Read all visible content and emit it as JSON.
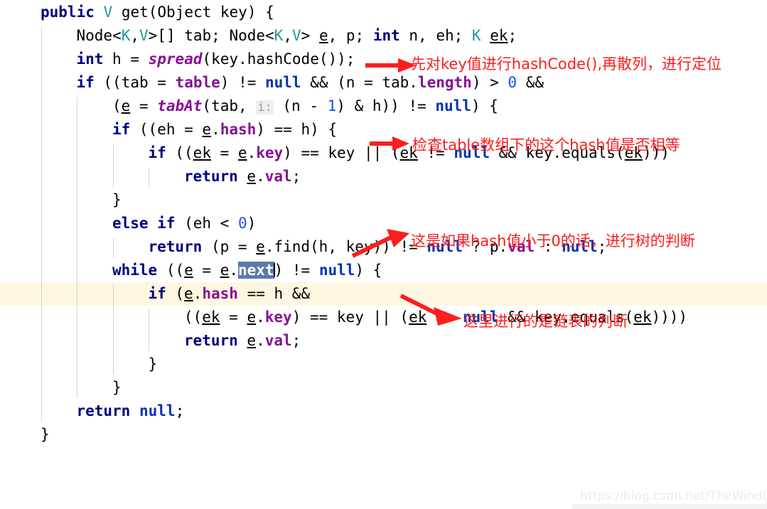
{
  "editor": {
    "language": "java",
    "highlighted_line_index": 12,
    "selection": {
      "text": "next",
      "line_index": 12
    },
    "inlay_hints": [
      {
        "text": "i:",
        "line_index": 4
      }
    ],
    "colors": {
      "background": "#ffffff",
      "caret_row": "#fdf6e0",
      "selection": "#5b79ad",
      "keyword": "#000080",
      "type_param": "#20999d",
      "field": "#871094",
      "number": "#1750eb",
      "null_keyword": "#0033b3",
      "indent_guide": "#d4d4d4",
      "annotation_red": "#fc1d1d"
    },
    "lines": [
      {
        "indent": 0,
        "tokens": [
          {
            "t": "public",
            "c": "kw"
          },
          {
            "t": " ",
            "c": "plain"
          },
          {
            "t": "V",
            "c": "type"
          },
          {
            "t": " get(Object key) {",
            "c": "plain"
          }
        ]
      },
      {
        "indent": 1,
        "tokens": [
          {
            "t": "Node<",
            "c": "plain"
          },
          {
            "t": "K",
            "c": "type"
          },
          {
            "t": ",",
            "c": "plain"
          },
          {
            "t": "V",
            "c": "type"
          },
          {
            "t": ">[] tab; Node<",
            "c": "plain"
          },
          {
            "t": "K",
            "c": "type"
          },
          {
            "t": ",",
            "c": "plain"
          },
          {
            "t": "V",
            "c": "type"
          },
          {
            "t": "> ",
            "c": "plain"
          },
          {
            "t": "e",
            "c": "localvar"
          },
          {
            "t": ", p; ",
            "c": "plain"
          },
          {
            "t": "int",
            "c": "kw"
          },
          {
            "t": " n, eh; ",
            "c": "plain"
          },
          {
            "t": "K",
            "c": "type"
          },
          {
            "t": " ",
            "c": "plain"
          },
          {
            "t": "ek",
            "c": "localvar"
          },
          {
            "t": ";",
            "c": "plain"
          }
        ]
      },
      {
        "indent": 1,
        "tokens": [
          {
            "t": "int",
            "c": "kw"
          },
          {
            "t": " h = ",
            "c": "plain"
          },
          {
            "t": "spread",
            "c": "static"
          },
          {
            "t": "(key.hashCode());",
            "c": "plain"
          }
        ]
      },
      {
        "indent": 1,
        "tokens": [
          {
            "t": "if",
            "c": "kw"
          },
          {
            "t": " ((tab = ",
            "c": "plain"
          },
          {
            "t": "table",
            "c": "field"
          },
          {
            "t": ") != ",
            "c": "plain"
          },
          {
            "t": "null",
            "c": "nullkw"
          },
          {
            "t": " && (n = tab.",
            "c": "plain"
          },
          {
            "t": "length",
            "c": "field"
          },
          {
            "t": ") > ",
            "c": "plain"
          },
          {
            "t": "0",
            "c": "num"
          },
          {
            "t": " &&",
            "c": "plain"
          }
        ]
      },
      {
        "indent": 2,
        "tokens": [
          {
            "t": "(",
            "c": "plain"
          },
          {
            "t": "e",
            "c": "localvar"
          },
          {
            "t": " = ",
            "c": "plain"
          },
          {
            "t": "tabAt",
            "c": "static"
          },
          {
            "t": "(tab, ",
            "c": "plain"
          },
          {
            "t": "i:",
            "c": "inlay"
          },
          {
            "t": " (n - ",
            "c": "plain"
          },
          {
            "t": "1",
            "c": "num"
          },
          {
            "t": ") & h)) != ",
            "c": "plain"
          },
          {
            "t": "null",
            "c": "nullkw"
          },
          {
            "t": ") {",
            "c": "plain"
          }
        ]
      },
      {
        "indent": 2,
        "tokens": [
          {
            "t": "if",
            "c": "kw"
          },
          {
            "t": " ((eh = ",
            "c": "plain"
          },
          {
            "t": "e",
            "c": "localvar"
          },
          {
            "t": ".",
            "c": "plain"
          },
          {
            "t": "hash",
            "c": "field"
          },
          {
            "t": ") == h) {",
            "c": "plain"
          }
        ]
      },
      {
        "indent": 3,
        "tokens": [
          {
            "t": "if",
            "c": "kw"
          },
          {
            "t": " ((",
            "c": "plain"
          },
          {
            "t": "ek",
            "c": "localvar"
          },
          {
            "t": " = ",
            "c": "plain"
          },
          {
            "t": "e",
            "c": "localvar"
          },
          {
            "t": ".",
            "c": "plain"
          },
          {
            "t": "key",
            "c": "field"
          },
          {
            "t": ") == key || (",
            "c": "plain"
          },
          {
            "t": "ek",
            "c": "localvar"
          },
          {
            "t": " != ",
            "c": "plain"
          },
          {
            "t": "null",
            "c": "nullkw"
          },
          {
            "t": " && key.equals(",
            "c": "plain"
          },
          {
            "t": "ek",
            "c": "localvar"
          },
          {
            "t": ")))",
            "c": "plain"
          }
        ]
      },
      {
        "indent": 4,
        "tokens": [
          {
            "t": "return",
            "c": "kw"
          },
          {
            "t": " ",
            "c": "plain"
          },
          {
            "t": "e",
            "c": "localvar"
          },
          {
            "t": ".",
            "c": "plain"
          },
          {
            "t": "val",
            "c": "field"
          },
          {
            "t": ";",
            "c": "plain"
          }
        ]
      },
      {
        "indent": 2,
        "tokens": [
          {
            "t": "}",
            "c": "plain"
          }
        ]
      },
      {
        "indent": 2,
        "tokens": [
          {
            "t": "else if",
            "c": "kw"
          },
          {
            "t": " (eh < ",
            "c": "plain"
          },
          {
            "t": "0",
            "c": "num"
          },
          {
            "t": ")",
            "c": "plain"
          }
        ]
      },
      {
        "indent": 3,
        "tokens": [
          {
            "t": "return",
            "c": "kw"
          },
          {
            "t": " (p = ",
            "c": "plain"
          },
          {
            "t": "e",
            "c": "localvar"
          },
          {
            "t": ".find(h, key)) != ",
            "c": "plain"
          },
          {
            "t": "null",
            "c": "nullkw"
          },
          {
            "t": " ? p.",
            "c": "plain"
          },
          {
            "t": "val",
            "c": "field"
          },
          {
            "t": " : ",
            "c": "plain"
          },
          {
            "t": "null",
            "c": "nullkw"
          },
          {
            "t": ";",
            "c": "plain"
          }
        ]
      },
      {
        "indent": 2,
        "tokens": [
          {
            "t": "while",
            "c": "kw"
          },
          {
            "t": " ((",
            "c": "plain"
          },
          {
            "t": "e",
            "c": "localvar"
          },
          {
            "t": " = ",
            "c": "plain"
          },
          {
            "t": "e",
            "c": "localvar"
          },
          {
            "t": ".",
            "c": "plain"
          },
          {
            "t": "next",
            "c": "sel"
          },
          {
            "t": ") != ",
            "c": "plain"
          },
          {
            "t": "null",
            "c": "nullkw"
          },
          {
            "t": ") {",
            "c": "plain"
          }
        ]
      },
      {
        "indent": 3,
        "tokens": [
          {
            "t": "if",
            "c": "kw"
          },
          {
            "t": " (",
            "c": "plain"
          },
          {
            "t": "e",
            "c": "localvar"
          },
          {
            "t": ".",
            "c": "plain"
          },
          {
            "t": "hash",
            "c": "field"
          },
          {
            "t": " == h &&",
            "c": "plain"
          }
        ]
      },
      {
        "indent": 4,
        "tokens": [
          {
            "t": "((",
            "c": "plain"
          },
          {
            "t": "ek",
            "c": "localvar"
          },
          {
            "t": " = ",
            "c": "plain"
          },
          {
            "t": "e",
            "c": "localvar"
          },
          {
            "t": ".",
            "c": "plain"
          },
          {
            "t": "key",
            "c": "field"
          },
          {
            "t": ") == key || (",
            "c": "plain"
          },
          {
            "t": "ek",
            "c": "localvar"
          },
          {
            "t": " != ",
            "c": "plain"
          },
          {
            "t": "null",
            "c": "nullkw"
          },
          {
            "t": " && key.equals(",
            "c": "plain"
          },
          {
            "t": "ek",
            "c": "localvar"
          },
          {
            "t": "))))",
            "c": "plain"
          }
        ]
      },
      {
        "indent": 4,
        "tokens": [
          {
            "t": "return",
            "c": "kw"
          },
          {
            "t": " ",
            "c": "plain"
          },
          {
            "t": "e",
            "c": "localvar"
          },
          {
            "t": ".",
            "c": "plain"
          },
          {
            "t": "val",
            "c": "field"
          },
          {
            "t": ";",
            "c": "plain"
          }
        ]
      },
      {
        "indent": 3,
        "tokens": [
          {
            "t": "}",
            "c": "plain"
          }
        ]
      },
      {
        "indent": 2,
        "tokens": [
          {
            "t": "}",
            "c": "plain"
          }
        ]
      },
      {
        "indent": 1,
        "tokens": [
          {
            "t": "return",
            "c": "kw"
          },
          {
            "t": " ",
            "c": "plain"
          },
          {
            "t": "null",
            "c": "nullkw"
          },
          {
            "t": ";",
            "c": "plain"
          }
        ]
      },
      {
        "indent": 0,
        "tokens": [
          {
            "t": "}",
            "c": "plain"
          }
        ]
      }
    ]
  },
  "annotations": [
    {
      "id": "ann-hashcode",
      "text": "先对key值进行hashCode(),再散列，进行定位"
    },
    {
      "id": "ann-hash-equal",
      "text": "检查table数组下的这个hash值是否相等"
    },
    {
      "id": "ann-tree",
      "text": "这是如果hash值小于0的话，进行树的判断"
    },
    {
      "id": "ann-linkedlist",
      "text": "这里进行的是链表的判断"
    }
  ],
  "watermark": {
    "text": "https://blog.csdn.net/TheWindOfSon"
  }
}
